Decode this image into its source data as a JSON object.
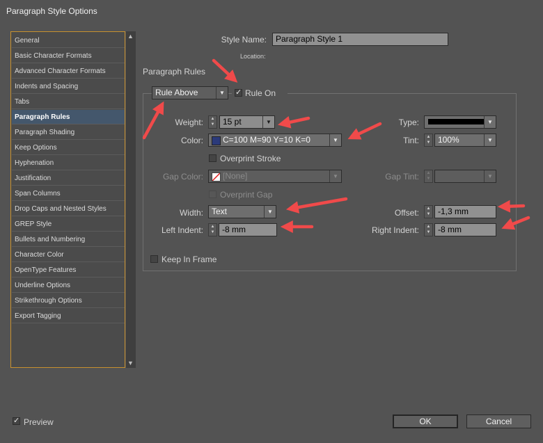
{
  "window": {
    "title": "Paragraph Style Options"
  },
  "sidebar": {
    "items": [
      {
        "label": "General"
      },
      {
        "label": "Basic Character Formats"
      },
      {
        "label": "Advanced Character Formats"
      },
      {
        "label": "Indents and Spacing"
      },
      {
        "label": "Tabs"
      },
      {
        "label": "Paragraph Rules",
        "selected": true
      },
      {
        "label": "Paragraph Shading"
      },
      {
        "label": "Keep Options"
      },
      {
        "label": "Hyphenation"
      },
      {
        "label": "Justification"
      },
      {
        "label": "Span Columns"
      },
      {
        "label": "Drop Caps and Nested Styles"
      },
      {
        "label": "GREP Style"
      },
      {
        "label": "Bullets and Numbering"
      },
      {
        "label": "Character Color"
      },
      {
        "label": "OpenType Features"
      },
      {
        "label": "Underline Options"
      },
      {
        "label": "Strikethrough Options"
      },
      {
        "label": "Export Tagging"
      }
    ]
  },
  "header": {
    "style_name_label": "Style Name:",
    "style_name_value": "Paragraph Style 1",
    "location_label": "Location:"
  },
  "section": {
    "title": "Paragraph Rules"
  },
  "rule": {
    "position_value": "Rule Above",
    "rule_on_label": "Rule On",
    "rule_on_checked": true
  },
  "fields": {
    "weight_label": "Weight:",
    "weight_value": "15 pt",
    "type_label": "Type:",
    "color_label": "Color:",
    "color_value": "C=100 M=90 Y=10 K=0",
    "color_swatch": "#2b3a7a",
    "tint_label": "Tint:",
    "tint_value": "100%",
    "overprint_stroke_label": "Overprint Stroke",
    "gap_color_label": "Gap Color:",
    "gap_color_value": "[None]",
    "gap_tint_label": "Gap Tint:",
    "overprint_gap_label": "Overprint Gap",
    "width_label": "Width:",
    "width_value": "Text",
    "offset_label": "Offset:",
    "offset_value": "-1,3 mm",
    "left_indent_label": "Left Indent:",
    "left_indent_value": "-8 mm",
    "right_indent_label": "Right Indent:",
    "right_indent_value": "-8 mm",
    "keep_in_frame_label": "Keep In Frame"
  },
  "footer": {
    "preview_label": "Preview",
    "preview_checked": true,
    "ok_label": "OK",
    "cancel_label": "Cancel"
  },
  "colors": {
    "annotation_arrow": "#f04a4a",
    "selection_border": "#c8912e"
  }
}
